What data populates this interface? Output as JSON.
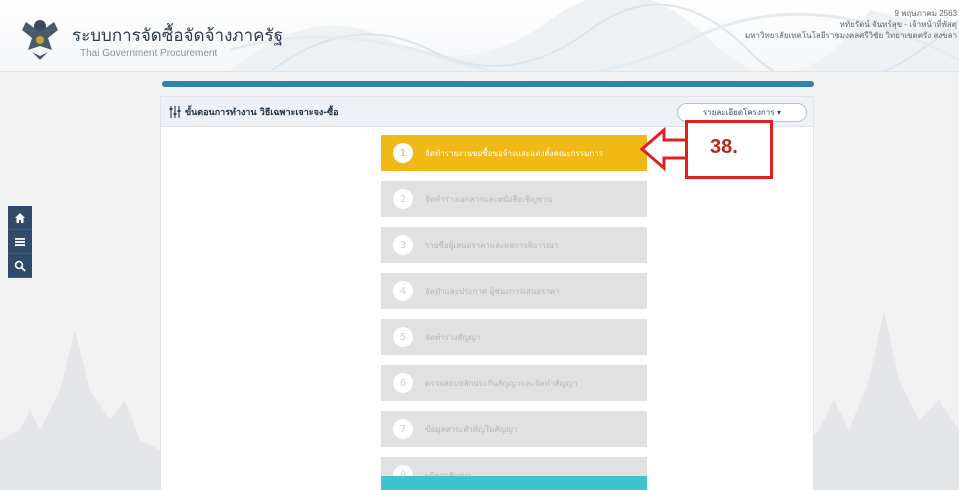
{
  "header": {
    "title": "ระบบการจัดซื้อจัดจ้างภาครัฐ",
    "subtitle": "Thai Government Procurement",
    "date": "9 พฤษภาคม 2563",
    "user_name": "หทัยรัตน์ จันทร์สุข - เจ้าหน้าที่พัสดุ",
    "organization": "มหาวิทยาลัยเทคโนโลยีราชมงคลศรีวิชัย วิทยาเขตตรัง สงขลา"
  },
  "float_toolbar": {
    "icons": [
      "home-icon",
      "menu-icon",
      "search-icon"
    ]
  },
  "panel": {
    "title": "ขั้นตอนการทำงาน วิธีเฉพาะเจาะจง-ซื้อ",
    "project_details_label": "รายละเอียดโครงการ ▾",
    "steps": [
      {
        "num": "1",
        "label": "จัดทำรายงานขอซื้อขอจ้างและแต่งตั้งคณะกรรมการ",
        "active": true
      },
      {
        "num": "2",
        "label": "จัดทำร่างเอกสารและหนังสือเชิญชวน",
        "active": false
      },
      {
        "num": "3",
        "label": "รายชื่อผู้เสนอราคาและผลการพิจารณา",
        "active": false
      },
      {
        "num": "4",
        "label": "จัดทำและประกาศ ผู้ชนะการเสนอราคา",
        "active": false
      },
      {
        "num": "5",
        "label": "จัดทำร่างสัญญา",
        "active": false
      },
      {
        "num": "6",
        "label": "ตรวจสอบหลักประกันสัญญาและจัดทำสัญญา",
        "active": false
      },
      {
        "num": "7",
        "label": "ข้อมูลสาระสำคัญในสัญญา",
        "active": false
      },
      {
        "num": "8",
        "label": "บริหารสัญญา",
        "active": false
      }
    ]
  },
  "annotation": {
    "label": "38."
  },
  "colors": {
    "active_step": "#f0b915",
    "inactive_step": "#e1e1e1",
    "top_bar": "#2e86ab",
    "annotation": "#e02020",
    "toolbar": "#2f4a6b"
  }
}
